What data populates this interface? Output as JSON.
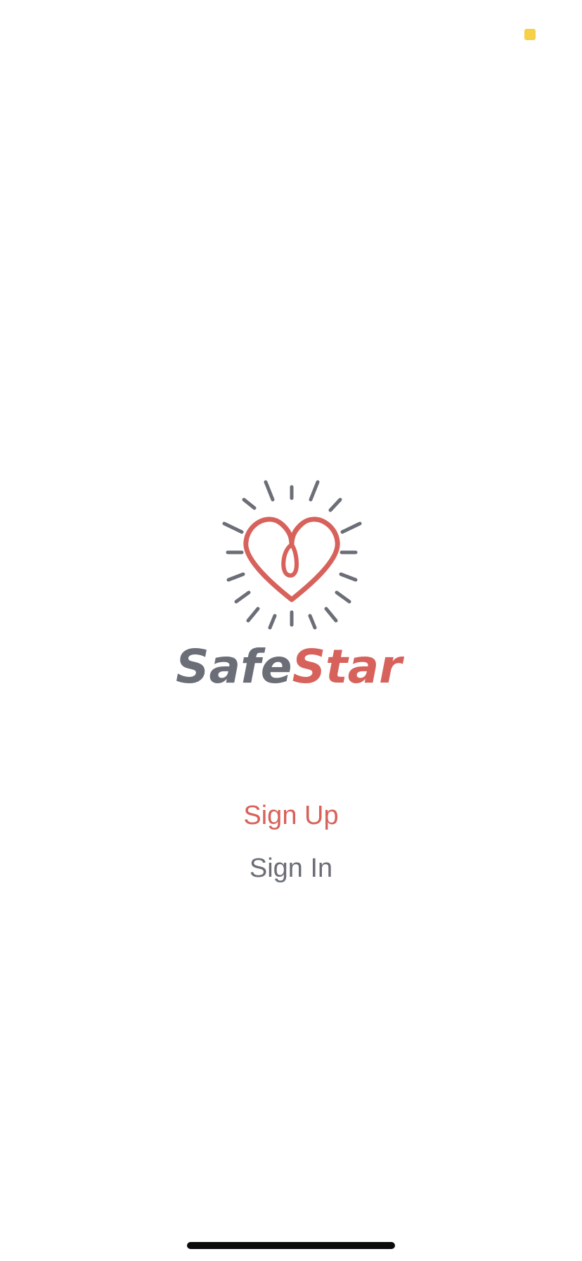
{
  "colors": {
    "brand_red": "#d7625b",
    "brand_gray": "#6b6e77",
    "status_dot": "#f6d046",
    "home_indicator": "#0b0b0b"
  },
  "logo": {
    "word_part1": "Safe",
    "word_part2": "Star",
    "icon": "heart-with-rays-icon"
  },
  "actions": {
    "sign_up_label": "Sign Up",
    "sign_in_label": "Sign In"
  }
}
